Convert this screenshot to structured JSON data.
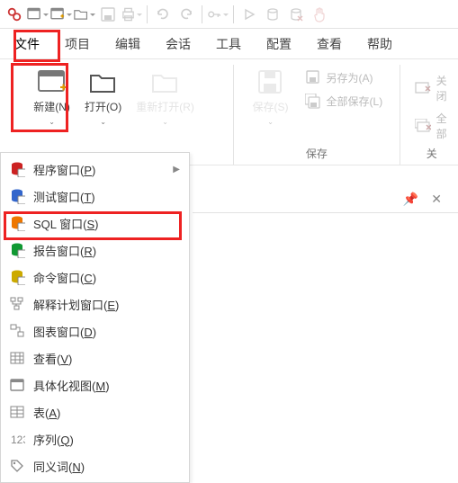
{
  "menubar": {
    "file": "文件",
    "project": "项目",
    "edit": "编辑",
    "session": "会话",
    "tools": "工具",
    "config": "配置",
    "view": "查看",
    "help": "帮助"
  },
  "ribbon": {
    "new": {
      "label": "新建(N)"
    },
    "open": {
      "label": "打开(O)"
    },
    "reopen": {
      "label": "重新打开(R)"
    },
    "save": {
      "label": "保存(S)"
    },
    "saveAs": {
      "label": "另存为(A)"
    },
    "saveAll": {
      "label": "全部保存(L)"
    },
    "close": {
      "label": "关闭"
    },
    "closeAll": {
      "label": "全部"
    },
    "group_save": "保存",
    "group_close": "关"
  },
  "submenu": {
    "program": {
      "label": "程序窗口(",
      "key": "P",
      "tail": ")"
    },
    "test": {
      "label": "测试窗口(",
      "key": "T",
      "tail": ")"
    },
    "sql": {
      "label": "SQL 窗口(",
      "key": "S",
      "tail": ")"
    },
    "report": {
      "label": "报告窗口(",
      "key": "R",
      "tail": ")"
    },
    "command": {
      "label": "命令窗口(",
      "key": "C",
      "tail": ")"
    },
    "explain": {
      "label": "解释计划窗口(",
      "key": "E",
      "tail": ")"
    },
    "diagram": {
      "label": "图表窗口(",
      "key": "D",
      "tail": ")"
    },
    "viewq": {
      "label": "查看(",
      "key": "V",
      "tail": ")"
    },
    "matview": {
      "label": "具体化视图(",
      "key": "M",
      "tail": ")"
    },
    "table": {
      "label": "表(",
      "key": "A",
      "tail": ")"
    },
    "sequence": {
      "label": "序列(",
      "key": "Q",
      "tail": ")"
    },
    "synonym": {
      "label": "同义词(",
      "key": "N",
      "tail": ")"
    }
  }
}
